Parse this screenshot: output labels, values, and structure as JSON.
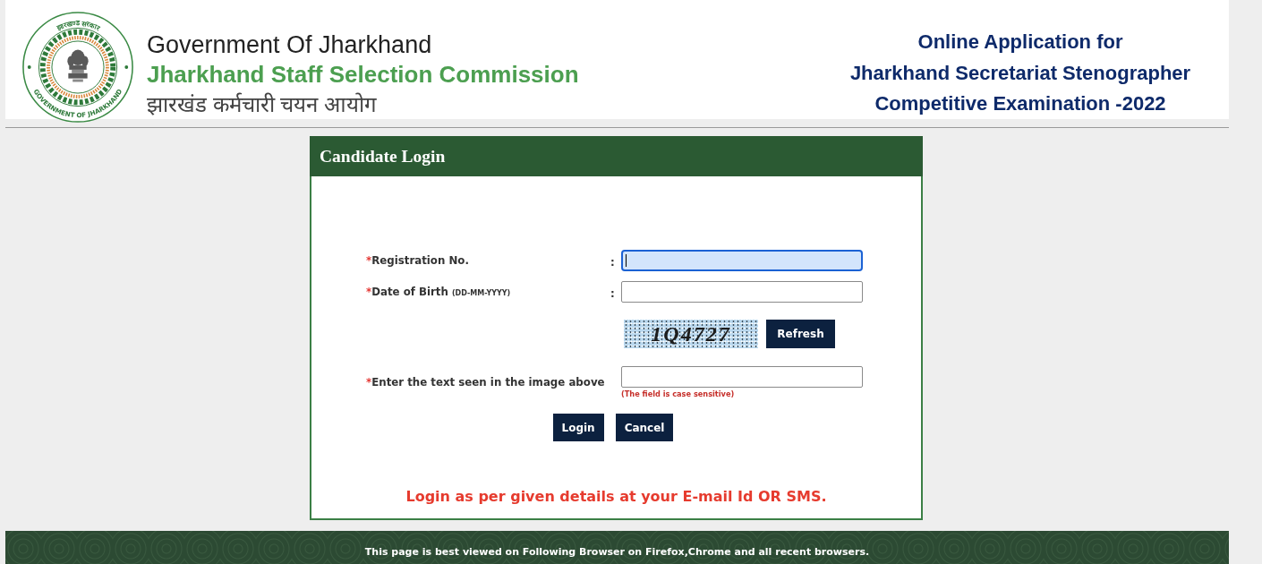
{
  "header": {
    "emblem_top_text": "झारखण्ड सरकार",
    "emblem_bottom_text": "GOVERNMENT OF JHARKHAND",
    "government": "Government Of Jharkhand",
    "commission": "Jharkhand Staff Selection Commission",
    "commission_hindi": "झारखंड कर्मचारी चयन आयोग",
    "title_lines": [
      "Online Application for",
      "Jharkhand Secretariat Stenographer",
      "Competitive Examination -2022"
    ]
  },
  "login_panel": {
    "title": "Candidate Login",
    "fields": [
      {
        "kind": "text",
        "required_mark": "*",
        "label": "Registration No.",
        "separator": ":",
        "focused": true
      },
      {
        "kind": "text",
        "required_mark": "*",
        "label": "Date of Birth",
        "format": "(DD-MM-YYYY)",
        "separator": ":",
        "focused": false
      },
      {
        "kind": "captcha",
        "code": "1Q4727",
        "button": "Refresh"
      },
      {
        "kind": "text",
        "required_mark": "*",
        "label": "Enter the text seen in the image above",
        "focused": false,
        "note": "(The field is case sensitive)"
      }
    ],
    "buttons": [
      "Login",
      "Cancel"
    ],
    "notice": "Login as per given details at your E-mail Id OR SMS."
  },
  "footer": {
    "text": "This page is best viewed on Following Browser on Firefox,Chrome and all recent browsers."
  }
}
